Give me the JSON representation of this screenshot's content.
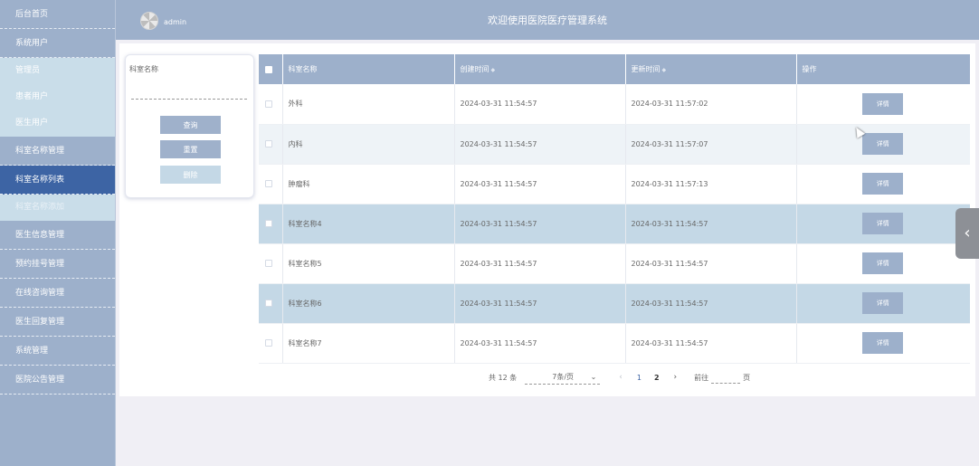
{
  "header": {
    "title": "欢迎使用医院医疗管理系统",
    "admin_name": "admin"
  },
  "sidebar": {
    "items": [
      {
        "label": "后台首页"
      },
      {
        "label": "系统用户"
      }
    ],
    "system_user_sub": [
      "管理员",
      "患者用户",
      "医生用户"
    ],
    "dept_group_label": "科室名称管理",
    "dept_sub": [
      "科室名称列表",
      "科室名称添加"
    ],
    "bottom_items": [
      "医生信息管理",
      "预约挂号管理",
      "在线咨询管理",
      "医生回复管理",
      "系统管理",
      "医院公告管理"
    ]
  },
  "search": {
    "label": "科室名称",
    "query_btn": "查询",
    "reset_btn": "重置",
    "delete_btn": "删除"
  },
  "table": {
    "columns": [
      "科室名称",
      "创建时间",
      "更新时间",
      "操作"
    ],
    "detail_label": "详情",
    "rows": [
      {
        "name": "外科",
        "created": "2024-03-31 11:54:57",
        "updated": "2024-03-31 11:57:02"
      },
      {
        "name": "内科",
        "created": "2024-03-31 11:54:57",
        "updated": "2024-03-31 11:57:07"
      },
      {
        "name": "肿瘤科",
        "created": "2024-03-31 11:54:57",
        "updated": "2024-03-31 11:57:13"
      },
      {
        "name": "科室名称4",
        "created": "2024-03-31 11:54:57",
        "updated": "2024-03-31 11:54:57"
      },
      {
        "name": "科室名称5",
        "created": "2024-03-31 11:54:57",
        "updated": "2024-03-31 11:54:57"
      },
      {
        "name": "科室名称6",
        "created": "2024-03-31 11:54:57",
        "updated": "2024-03-31 11:54:57"
      },
      {
        "name": "科室名称7",
        "created": "2024-03-31 11:54:57",
        "updated": "2024-03-31 11:54:57"
      }
    ]
  },
  "pagination": {
    "total": "共 12 条",
    "page_size": "7条/页",
    "pages": [
      "1",
      "2"
    ],
    "goto_label": "前往",
    "page_suffix": "页"
  },
  "colors": {
    "sidebar_bg": "#9db0cb",
    "active_nav": "#3d64a4",
    "selected_row": "#c4d8e6"
  }
}
